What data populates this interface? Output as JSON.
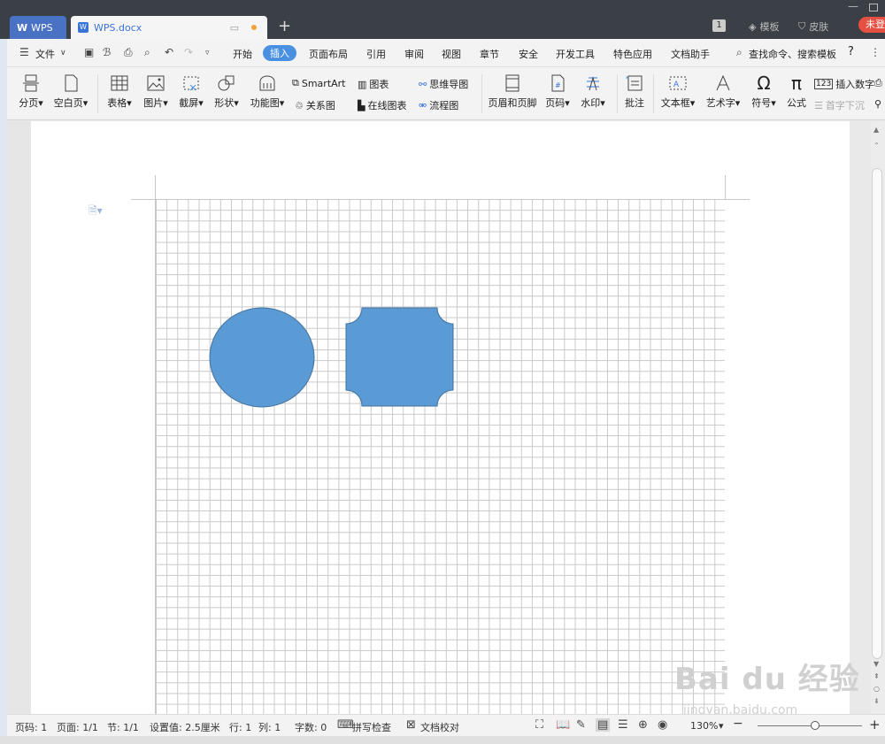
{
  "titlebar": {
    "tab_wps": "WPS",
    "tab_doc": "WPS.docx",
    "new_tab": "+",
    "badge": "1",
    "templates": "模板",
    "skin": "皮肤",
    "login": "未登",
    "minimize": "—"
  },
  "menu": {
    "file": "文件",
    "items": [
      "开始",
      "插入",
      "页面布局",
      "引用",
      "审阅",
      "视图",
      "章节",
      "安全",
      "开发工具",
      "特色应用",
      "文档助手"
    ],
    "active": "插入",
    "search": "查找命令、搜索模板",
    "help": "?"
  },
  "ribbon": {
    "page_break": "分页",
    "blank_page": "空白页",
    "table": "表格",
    "picture": "图片",
    "screenshot": "截屏",
    "shape": "形状",
    "function_chart": "功能图",
    "smartart": "SmartArt",
    "chart": "图表",
    "mind_map": "思维导图",
    "relation": "关系图",
    "online_chart": "在线图表",
    "flowchart": "流程图",
    "header_footer": "页眉和页脚",
    "page_number": "页码",
    "watermark": "水印",
    "comment": "批注",
    "text_box": "文本框",
    "word_art": "艺术字",
    "symbol": "符号",
    "formula": "公式",
    "insert_number": "插入数字",
    "drop_cap": "首字下沉"
  },
  "status": {
    "page_code": "页码: 1",
    "pages": "页面: 1/1",
    "section": "节: 1/1",
    "setting": "设置值: 2.5厘米",
    "row": "行: 1",
    "col": "列: 1",
    "words": "字数: 0",
    "spell": "拼写检查",
    "proof": "文档校对",
    "zoom": "130%",
    "zoom_minus": "−",
    "zoom_plus": "+"
  },
  "watermark": {
    "main": "Bai du 经验",
    "sub": "jingyan.baidu.com"
  },
  "colors": {
    "shape_fill": "#5b9bd5",
    "shape_stroke": "#41719c",
    "accent": "#4a90e2"
  }
}
